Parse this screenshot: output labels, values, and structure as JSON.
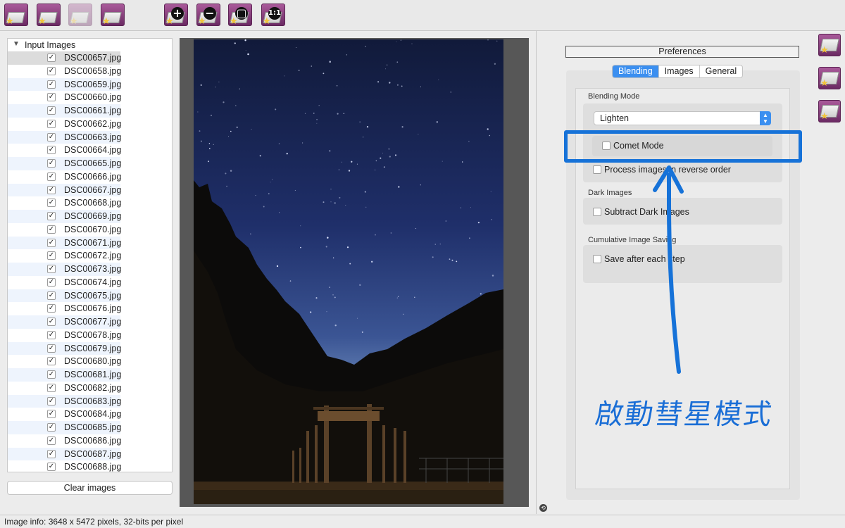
{
  "toolbar": {
    "buttons": [
      {
        "name": "open-images-icon",
        "glyph": ""
      },
      {
        "name": "open-dark-images-icon",
        "glyph": ""
      },
      {
        "name": "save-image-icon",
        "glyph": ""
      },
      {
        "name": "export-icon",
        "glyph": ""
      },
      {
        "name": "zoom-in-icon",
        "glyph": "+"
      },
      {
        "name": "zoom-out-icon",
        "glyph": "−"
      },
      {
        "name": "zoom-fit-icon",
        "glyph": "▢"
      },
      {
        "name": "zoom-actual-size-icon",
        "glyph": "1:1"
      }
    ]
  },
  "file_list": {
    "header": "Input Images",
    "files": [
      "DSC00657.jpg",
      "DSC00658.jpg",
      "DSC00659.jpg",
      "DSC00660.jpg",
      "DSC00661.jpg",
      "DSC00662.jpg",
      "DSC00663.jpg",
      "DSC00664.jpg",
      "DSC00665.jpg",
      "DSC00666.jpg",
      "DSC00667.jpg",
      "DSC00668.jpg",
      "DSC00669.jpg",
      "DSC00670.jpg",
      "DSC00671.jpg",
      "DSC00672.jpg",
      "DSC00673.jpg",
      "DSC00674.jpg",
      "DSC00675.jpg",
      "DSC00676.jpg",
      "DSC00677.jpg",
      "DSC00678.jpg",
      "DSC00679.jpg",
      "DSC00680.jpg",
      "DSC00681.jpg",
      "DSC00682.jpg",
      "DSC00683.jpg",
      "DSC00684.jpg",
      "DSC00685.jpg",
      "DSC00686.jpg",
      "DSC00687.jpg",
      "DSC00688.jpg"
    ],
    "checked": true,
    "clear_label": "Clear images"
  },
  "preferences": {
    "title": "Preferences",
    "tabs": [
      "Blending",
      "Images",
      "General"
    ],
    "active_tab": "Blending",
    "blending_mode_label": "Blending Mode",
    "blending_mode_value": "Lighten",
    "comet_mode_label": "Comet Mode",
    "reverse_order_label": "Process images in reverse order",
    "dark_images_label": "Dark Images",
    "subtract_dark_label": "Subtract Dark Images",
    "cumulative_label": "Cumulative Image Saving",
    "save_each_step_label": "Save after each step"
  },
  "annotation": {
    "note": "啟動彗星模式",
    "color": "#1a6ed6"
  },
  "side_icons": [
    "blend-settings-icon",
    "magic-wand-icon",
    "effects-icon"
  ],
  "status": "Image info: 3648 x 5472 pixels, 32-bits per pixel",
  "colors": {
    "accent": "#3b8ff0",
    "toolbar_icon": "#8e4282",
    "highlight": "#1672d8"
  }
}
